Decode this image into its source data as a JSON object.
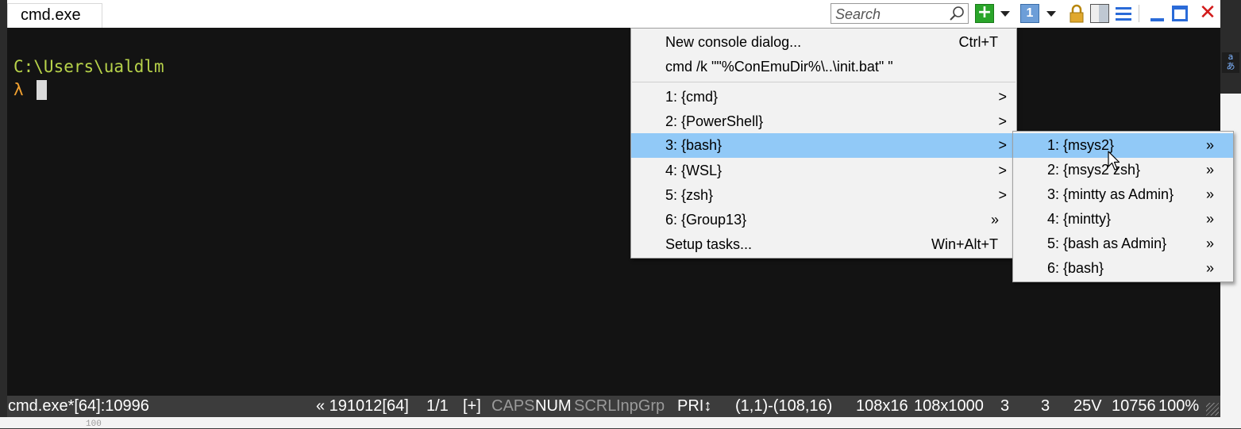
{
  "window": {
    "tab_title": "cmd.exe"
  },
  "toolbar": {
    "search_placeholder": "Search",
    "icons": [
      "search-icon",
      "new-console-icon",
      "dropdown-icon",
      "console-number-icon",
      "lock-icon",
      "split-icon",
      "menu-icon",
      "minimize-icon",
      "maximize-icon",
      "close-icon"
    ],
    "console_number": "1"
  },
  "console": {
    "path": "C:\\Users\\ualdlm",
    "prompt": "λ"
  },
  "menu": {
    "items": [
      {
        "label": "New console dialog...",
        "shortcut": "Ctrl+T"
      },
      {
        "label": "cmd /k \"\"%ConEmuDir%\\..\\init.bat\" \""
      },
      {
        "label": "1: {cmd}",
        "submenu": ">"
      },
      {
        "label": "2: {PowerShell}",
        "submenu": ">"
      },
      {
        "label": "3: {bash}",
        "submenu": ">",
        "highlighted": true
      },
      {
        "label": "4: {WSL}",
        "submenu": ">"
      },
      {
        "label": "5: {zsh}",
        "submenu": ">"
      },
      {
        "label": "6: {Group13}",
        "submenu": "»"
      },
      {
        "label": "Setup tasks...",
        "shortcut": "Win+Alt+T"
      }
    ]
  },
  "submenu": {
    "items": [
      {
        "label": "1: {msys2}",
        "marker": "»",
        "highlighted": true
      },
      {
        "label": "2: {msys2 zsh}",
        "marker": "»"
      },
      {
        "label": "3: {mintty as Admin}",
        "marker": "»"
      },
      {
        "label": "4: {mintty}",
        "marker": "»"
      },
      {
        "label": "5: {bash as Admin}",
        "marker": "»"
      },
      {
        "label": "6: {bash}",
        "marker": "»"
      }
    ]
  },
  "statusbar": {
    "title": "cmd.exe*[64]:10996",
    "build": "« 191012[64]",
    "pages": "1/1",
    "plus": "[+]",
    "caps": "CAPS",
    "num": "NUM",
    "scrl": "SCRL",
    "inpgrp": "InpGrp",
    "pri": "PRI↕",
    "selection": "(1,1)-(108,16)",
    "size": "108x16",
    "buffer": "108x1000",
    "val1": "3",
    "val2": "3",
    "mode": "25V",
    "pid": "10756",
    "zoom": "100%"
  },
  "background": {
    "line_number": "100"
  },
  "colors": {
    "path": "#b7d24a",
    "prompt": "#f0a030",
    "menu_highlight": "#91c9f7",
    "console_bg": "#131313",
    "statusbar_bg": "#3c3c3c"
  }
}
